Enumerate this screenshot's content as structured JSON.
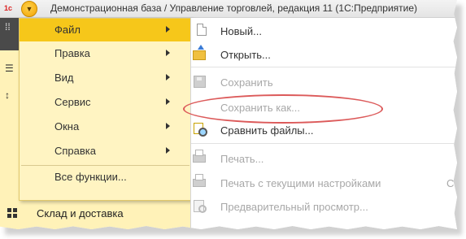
{
  "window": {
    "title": "Демонстрационная база / Управление торговлей, редакция 11  (1С:Предприятие)",
    "logo_text": "1с"
  },
  "main_menu": {
    "items": [
      {
        "label": "Файл",
        "active": true,
        "has_submenu": true
      },
      {
        "label": "Правка",
        "has_submenu": true
      },
      {
        "label": "Вид",
        "has_submenu": true
      },
      {
        "label": "Сервис",
        "has_submenu": true
      },
      {
        "label": "Окна",
        "has_submenu": true
      },
      {
        "label": "Справка",
        "has_submenu": true
      },
      {
        "label": "Все функции...",
        "has_submenu": false
      }
    ]
  },
  "file_submenu": {
    "items": [
      {
        "label": "Новый...",
        "icon": "new-document-icon",
        "enabled": true
      },
      {
        "label": "Открыть...",
        "icon": "open-folder-icon",
        "enabled": true
      },
      {
        "label": "Сохранить",
        "icon": "save-disk-icon",
        "enabled": false
      },
      {
        "label": "Сохранить как...",
        "icon": "",
        "enabled": false,
        "highlighted": true
      },
      {
        "label": "Сравнить файлы...",
        "icon": "compare-files-icon",
        "enabled": true
      },
      {
        "label": "Печать...",
        "icon": "printer-icon",
        "enabled": false
      },
      {
        "label": "Печать с текущими настройками",
        "icon": "printer-icon",
        "enabled": false,
        "shortcut": "Ctrl+"
      },
      {
        "label": "Предварительный просмотр...",
        "icon": "print-preview-icon",
        "enabled": false
      }
    ]
  },
  "side_panel": {
    "section_label": "Склад и доставка",
    "section_icon": "grid-icon"
  },
  "colors": {
    "menu_background": "#fff4c2",
    "menu_active": "#f6c71a",
    "disabled_text": "#a8a8a8",
    "highlight_ellipse": "#dc5a5a"
  }
}
